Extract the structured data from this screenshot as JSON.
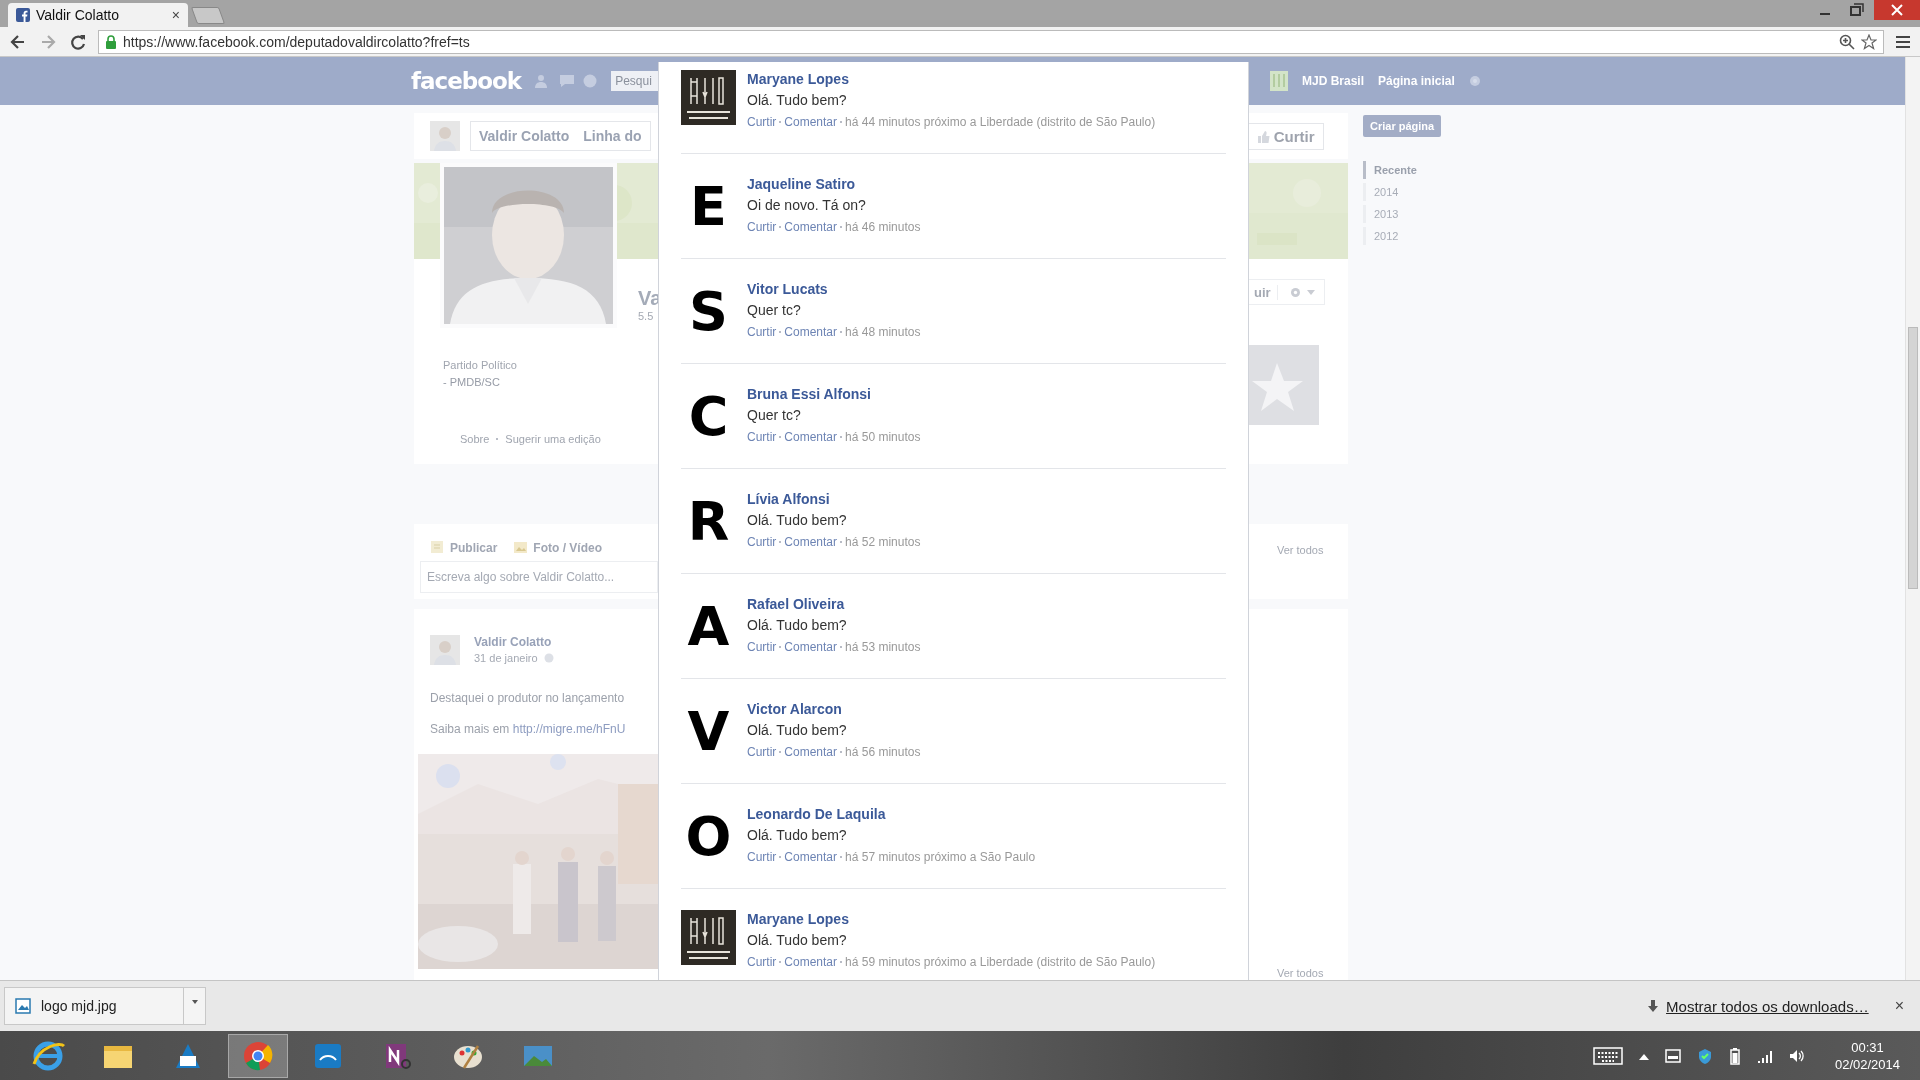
{
  "browser": {
    "tab": {
      "title": "Valdir Colatto",
      "close": "×"
    },
    "url": "https://www.facebook.com/deputadovaldircolatto?fref=ts"
  },
  "facebook": {
    "logo": "facebook",
    "search": {
      "placeholder": "Pesqui"
    },
    "nav": [
      "MJD Brasil",
      "Página inicial"
    ]
  },
  "page": {
    "header_tabs": [
      "Valdir Colatto",
      "Linha do"
    ],
    "like_button": "Curtir",
    "name_partial": "Va",
    "likes_partial": "5.5",
    "category": "Partido Político",
    "about_line": "- PMDB/SC",
    "about_links": [
      "Sobre",
      "Sugerir uma edição"
    ],
    "action_button_partial": "uir",
    "composer": {
      "tabs": [
        "Publicar",
        "Foto / Vídeo"
      ],
      "placeholder": "Escreva algo sobre Valdir Colatto..."
    },
    "see_all": [
      "Ver todos",
      "Ver todos"
    ],
    "post": {
      "author": "Valdir Colatto",
      "date": "31 de janeiro",
      "text": "Destaquei o produtor no lançamento",
      "link_prefix": "Saiba mais em",
      "link": "http://migre.me/hFnU"
    }
  },
  "sidebar": {
    "create_button": "Criar página",
    "timeline": [
      {
        "label": "Recente",
        "selected": true
      },
      {
        "label": "2014",
        "selected": false
      },
      {
        "label": "2013",
        "selected": false
      },
      {
        "label": "2012",
        "selected": false
      }
    ]
  },
  "comments": [
    {
      "avatar": {
        "kind": "logo"
      },
      "name": "Maryane Lopes",
      "message": "Olá. Tudo bem?",
      "actions": [
        "Curtir",
        "Comentar"
      ],
      "meta": "há 44 minutos próximo a Liberdade (distrito de São Paulo)"
    },
    {
      "avatar": {
        "kind": "letter",
        "letter": "E"
      },
      "name": "Jaqueline Satiro",
      "message": "Oi de novo. Tá on?",
      "actions": [
        "Curtir",
        "Comentar"
      ],
      "meta": "há 46 minutos"
    },
    {
      "avatar": {
        "kind": "letter",
        "letter": "S"
      },
      "name": "Vitor Lucats",
      "message": "Quer tc?",
      "actions": [
        "Curtir",
        "Comentar"
      ],
      "meta": "há 48 minutos"
    },
    {
      "avatar": {
        "kind": "letter",
        "letter": "C"
      },
      "name": "Bruna Essi Alfonsi",
      "message": "Quer tc?",
      "actions": [
        "Curtir",
        "Comentar"
      ],
      "meta": "há 50 minutos"
    },
    {
      "avatar": {
        "kind": "letter",
        "letter": "R"
      },
      "name": "Lívia Alfonsi",
      "message": "Olá. Tudo bem?",
      "actions": [
        "Curtir",
        "Comentar"
      ],
      "meta": "há 52 minutos"
    },
    {
      "avatar": {
        "kind": "letter",
        "letter": "A"
      },
      "name": "Rafael Oliveira",
      "message": "Olá. Tudo bem?",
      "actions": [
        "Curtir",
        "Comentar"
      ],
      "meta": "há 53 minutos"
    },
    {
      "avatar": {
        "kind": "letter",
        "letter": "V"
      },
      "name": "Victor Alarcon",
      "message": "Olá. Tudo bem?",
      "actions": [
        "Curtir",
        "Comentar"
      ],
      "meta": "há 56 minutos"
    },
    {
      "avatar": {
        "kind": "letter",
        "letter": "O"
      },
      "name": "Leonardo De Laquila",
      "message": "Olá. Tudo bem?",
      "actions": [
        "Curtir",
        "Comentar"
      ],
      "meta": "há 57 minutos próximo a São Paulo"
    },
    {
      "avatar": {
        "kind": "logo"
      },
      "name": "Maryane Lopes",
      "message": "Olá. Tudo bem?",
      "actions": [
        "Curtir",
        "Comentar"
      ],
      "meta": "há 59 minutos próximo a Liberdade (distrito de São Paulo)"
    }
  ],
  "downloads": {
    "file": "logo mjd.jpg",
    "show_all": "Mostrar todos os downloads…",
    "close": "×"
  },
  "clock": {
    "time": "00:31",
    "date": "02/02/2014"
  }
}
